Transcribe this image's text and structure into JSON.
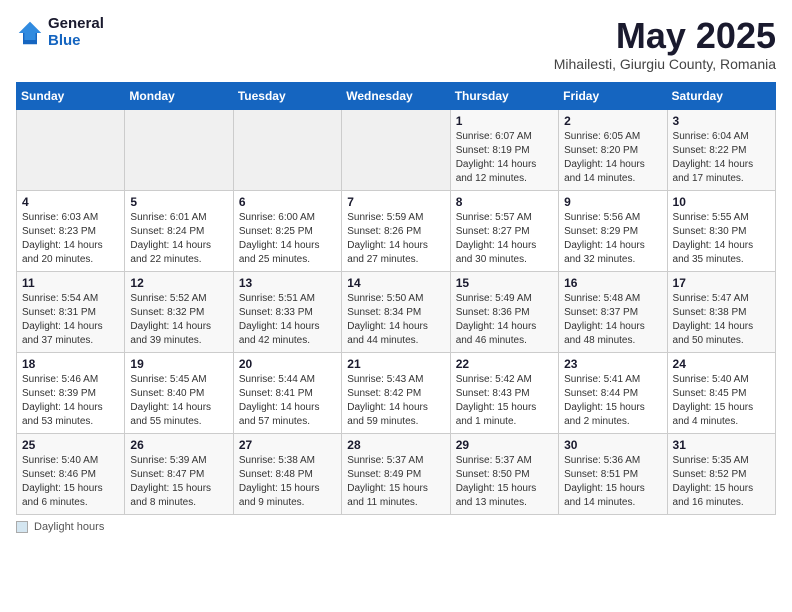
{
  "header": {
    "logo_general": "General",
    "logo_blue": "Blue",
    "month_title": "May 2025",
    "subtitle": "Mihailesti, Giurgiu County, Romania"
  },
  "footer": {
    "note": "Daylight hours"
  },
  "days_of_week": [
    "Sunday",
    "Monday",
    "Tuesday",
    "Wednesday",
    "Thursday",
    "Friday",
    "Saturday"
  ],
  "weeks": [
    [
      {
        "day": "",
        "info": ""
      },
      {
        "day": "",
        "info": ""
      },
      {
        "day": "",
        "info": ""
      },
      {
        "day": "",
        "info": ""
      },
      {
        "day": "1",
        "info": "Sunrise: 6:07 AM\nSunset: 8:19 PM\nDaylight: 14 hours\nand 12 minutes."
      },
      {
        "day": "2",
        "info": "Sunrise: 6:05 AM\nSunset: 8:20 PM\nDaylight: 14 hours\nand 14 minutes."
      },
      {
        "day": "3",
        "info": "Sunrise: 6:04 AM\nSunset: 8:22 PM\nDaylight: 14 hours\nand 17 minutes."
      }
    ],
    [
      {
        "day": "4",
        "info": "Sunrise: 6:03 AM\nSunset: 8:23 PM\nDaylight: 14 hours\nand 20 minutes."
      },
      {
        "day": "5",
        "info": "Sunrise: 6:01 AM\nSunset: 8:24 PM\nDaylight: 14 hours\nand 22 minutes."
      },
      {
        "day": "6",
        "info": "Sunrise: 6:00 AM\nSunset: 8:25 PM\nDaylight: 14 hours\nand 25 minutes."
      },
      {
        "day": "7",
        "info": "Sunrise: 5:59 AM\nSunset: 8:26 PM\nDaylight: 14 hours\nand 27 minutes."
      },
      {
        "day": "8",
        "info": "Sunrise: 5:57 AM\nSunset: 8:27 PM\nDaylight: 14 hours\nand 30 minutes."
      },
      {
        "day": "9",
        "info": "Sunrise: 5:56 AM\nSunset: 8:29 PM\nDaylight: 14 hours\nand 32 minutes."
      },
      {
        "day": "10",
        "info": "Sunrise: 5:55 AM\nSunset: 8:30 PM\nDaylight: 14 hours\nand 35 minutes."
      }
    ],
    [
      {
        "day": "11",
        "info": "Sunrise: 5:54 AM\nSunset: 8:31 PM\nDaylight: 14 hours\nand 37 minutes."
      },
      {
        "day": "12",
        "info": "Sunrise: 5:52 AM\nSunset: 8:32 PM\nDaylight: 14 hours\nand 39 minutes."
      },
      {
        "day": "13",
        "info": "Sunrise: 5:51 AM\nSunset: 8:33 PM\nDaylight: 14 hours\nand 42 minutes."
      },
      {
        "day": "14",
        "info": "Sunrise: 5:50 AM\nSunset: 8:34 PM\nDaylight: 14 hours\nand 44 minutes."
      },
      {
        "day": "15",
        "info": "Sunrise: 5:49 AM\nSunset: 8:36 PM\nDaylight: 14 hours\nand 46 minutes."
      },
      {
        "day": "16",
        "info": "Sunrise: 5:48 AM\nSunset: 8:37 PM\nDaylight: 14 hours\nand 48 minutes."
      },
      {
        "day": "17",
        "info": "Sunrise: 5:47 AM\nSunset: 8:38 PM\nDaylight: 14 hours\nand 50 minutes."
      }
    ],
    [
      {
        "day": "18",
        "info": "Sunrise: 5:46 AM\nSunset: 8:39 PM\nDaylight: 14 hours\nand 53 minutes."
      },
      {
        "day": "19",
        "info": "Sunrise: 5:45 AM\nSunset: 8:40 PM\nDaylight: 14 hours\nand 55 minutes."
      },
      {
        "day": "20",
        "info": "Sunrise: 5:44 AM\nSunset: 8:41 PM\nDaylight: 14 hours\nand 57 minutes."
      },
      {
        "day": "21",
        "info": "Sunrise: 5:43 AM\nSunset: 8:42 PM\nDaylight: 14 hours\nand 59 minutes."
      },
      {
        "day": "22",
        "info": "Sunrise: 5:42 AM\nSunset: 8:43 PM\nDaylight: 15 hours\nand 1 minute."
      },
      {
        "day": "23",
        "info": "Sunrise: 5:41 AM\nSunset: 8:44 PM\nDaylight: 15 hours\nand 2 minutes."
      },
      {
        "day": "24",
        "info": "Sunrise: 5:40 AM\nSunset: 8:45 PM\nDaylight: 15 hours\nand 4 minutes."
      }
    ],
    [
      {
        "day": "25",
        "info": "Sunrise: 5:40 AM\nSunset: 8:46 PM\nDaylight: 15 hours\nand 6 minutes."
      },
      {
        "day": "26",
        "info": "Sunrise: 5:39 AM\nSunset: 8:47 PM\nDaylight: 15 hours\nand 8 minutes."
      },
      {
        "day": "27",
        "info": "Sunrise: 5:38 AM\nSunset: 8:48 PM\nDaylight: 15 hours\nand 9 minutes."
      },
      {
        "day": "28",
        "info": "Sunrise: 5:37 AM\nSunset: 8:49 PM\nDaylight: 15 hours\nand 11 minutes."
      },
      {
        "day": "29",
        "info": "Sunrise: 5:37 AM\nSunset: 8:50 PM\nDaylight: 15 hours\nand 13 minutes."
      },
      {
        "day": "30",
        "info": "Sunrise: 5:36 AM\nSunset: 8:51 PM\nDaylight: 15 hours\nand 14 minutes."
      },
      {
        "day": "31",
        "info": "Sunrise: 5:35 AM\nSunset: 8:52 PM\nDaylight: 15 hours\nand 16 minutes."
      }
    ]
  ]
}
